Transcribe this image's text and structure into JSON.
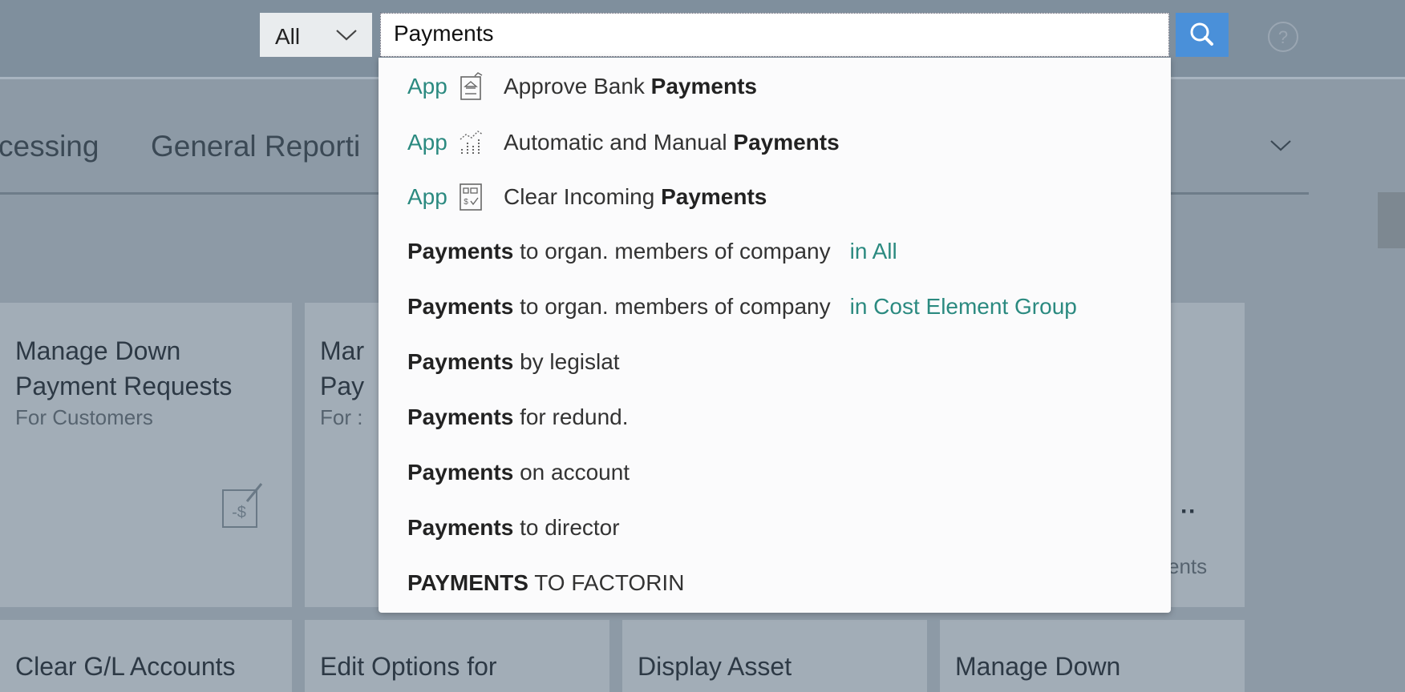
{
  "search": {
    "scope_value": "All",
    "query": "Payments"
  },
  "tabs": [
    {
      "label": "cessing"
    },
    {
      "label": "General Reporti"
    }
  ],
  "tiles": [
    {
      "title": "Manage Down\nPayment Requests",
      "subtitle": "For Customers"
    },
    {
      "title": "Mar\nPay",
      "subtitle": "For :"
    },
    {
      "title": "",
      "subtitle": "ents"
    },
    {
      "title": "Clear G/L Accounts"
    },
    {
      "title": "Edit Options for"
    },
    {
      "title": "Display Asset"
    },
    {
      "title": "Manage Down"
    }
  ],
  "suggestions": [
    {
      "tag": "App",
      "icon": "bank-approve-icon",
      "prefix": "Approve Bank ",
      "bold": "Payments",
      "suffix": "",
      "scope": ""
    },
    {
      "tag": "App",
      "icon": "chart-icon",
      "prefix": "Automatic and Manual ",
      "bold": "Payments",
      "suffix": "",
      "scope": ""
    },
    {
      "tag": "App",
      "icon": "clear-document-icon",
      "prefix": "Clear Incoming ",
      "bold": "Payments",
      "suffix": "",
      "scope": ""
    },
    {
      "tag": "",
      "icon": "",
      "prefix": "",
      "bold": "Payments",
      "suffix": " to organ. members of company",
      "scope": "in All"
    },
    {
      "tag": "",
      "icon": "",
      "prefix": "",
      "bold": "Payments",
      "suffix": " to organ. members of company",
      "scope": "in Cost Element Group"
    },
    {
      "tag": "",
      "icon": "",
      "prefix": "",
      "bold": "Payments",
      "suffix": " by legislat",
      "scope": ""
    },
    {
      "tag": "",
      "icon": "",
      "prefix": "",
      "bold": "Payments",
      "suffix": " for redund.",
      "scope": ""
    },
    {
      "tag": "",
      "icon": "",
      "prefix": "",
      "bold": "Payments",
      "suffix": " on account",
      "scope": ""
    },
    {
      "tag": "",
      "icon": "",
      "prefix": "",
      "bold": "Payments",
      "suffix": " to director",
      "scope": ""
    },
    {
      "tag": "",
      "icon": "",
      "prefix": "",
      "bold": "PAYMENTS",
      "suffix": " TO FACTORIN",
      "scope": ""
    }
  ],
  "colors": {
    "accent": "#2b8a80",
    "search_button": "#4a90d9"
  }
}
